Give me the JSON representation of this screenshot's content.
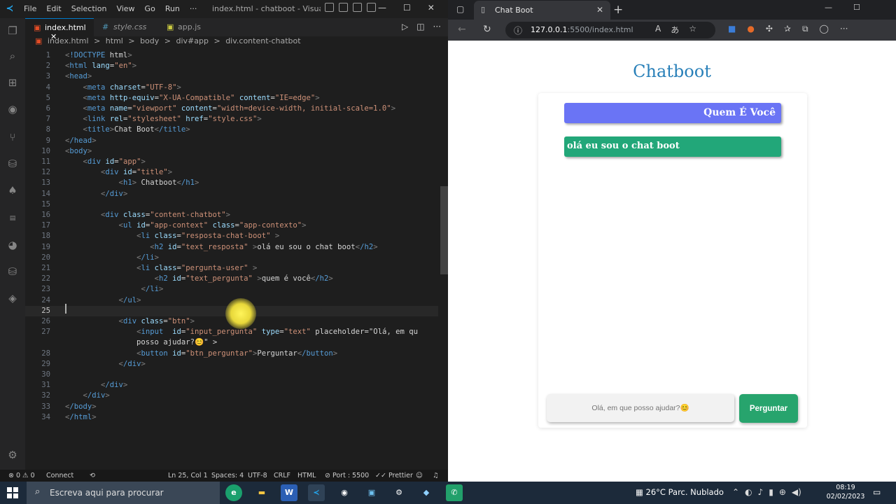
{
  "vscode": {
    "menu": [
      "File",
      "Edit",
      "Selection",
      "View",
      "Go",
      "Run",
      "···"
    ],
    "window_title": "index.html - chatboot - Visual Stud...",
    "window_controls": [
      "—",
      "☐",
      "✕"
    ],
    "tabs": [
      {
        "label": "index.html",
        "icon": "html5-icon",
        "active": true,
        "close": "✕"
      },
      {
        "label": "style.css",
        "icon": "css-icon",
        "active": false
      },
      {
        "label": "app.js",
        "icon": "js-icon",
        "active": false
      }
    ],
    "breadcrumb": [
      "index.html",
      ">",
      "html",
      ">",
      "body",
      ">",
      "div#app",
      ">",
      "div.content-chatbot"
    ],
    "code_lines": [
      {
        "n": "1",
        "code": "<!DOCTYPE html>"
      },
      {
        "n": "2",
        "code": "<html lang=\"en\">"
      },
      {
        "n": "3",
        "code": "<head>"
      },
      {
        "n": "4",
        "code": "    <meta charset=\"UTF-8\">"
      },
      {
        "n": "5",
        "code": "    <meta http-equiv=\"X-UA-Compatible\" content=\"IE=edge\">"
      },
      {
        "n": "6",
        "code": "    <meta name=\"viewport\" content=\"width=device-width, initial-scale=1.0\">"
      },
      {
        "n": "7",
        "code": "    <link rel=\"stylesheet\" href=\"style.css\">"
      },
      {
        "n": "8",
        "code": "    <title>Chat Boot</title>"
      },
      {
        "n": "9",
        "code": "</head>"
      },
      {
        "n": "10",
        "code": "<body>"
      },
      {
        "n": "11",
        "code": "    <div id=\"app\">"
      },
      {
        "n": "12",
        "code": "        <div id=\"title\">"
      },
      {
        "n": "13",
        "code": "            <h1> Chatboot</h1>"
      },
      {
        "n": "14",
        "code": "        </div>"
      },
      {
        "n": "15",
        "code": ""
      },
      {
        "n": "16",
        "code": "        <div class=\"content-chatbot\">"
      },
      {
        "n": "17",
        "code": "            <ul id=\"app-context\" class=\"app-contexto\">"
      },
      {
        "n": "18",
        "code": "                <li class=\"resposta-chat-boot\" >"
      },
      {
        "n": "19",
        "code": "                   <h2 id=\"text_resposta\" >olá eu sou o chat boot</h2>"
      },
      {
        "n": "20",
        "code": "                </li>"
      },
      {
        "n": "21",
        "code": "                <li class=\"pergunta-user\" >"
      },
      {
        "n": "22",
        "code": "                    <h2 id=\"text_pergunta\" >quem é você</h2>"
      },
      {
        "n": "23",
        "code": "                 </li>"
      },
      {
        "n": "24",
        "code": "            </ul>"
      },
      {
        "n": "25",
        "code": ""
      },
      {
        "n": "26",
        "code": "            <div class=\"btn\">"
      },
      {
        "n": "27",
        "code": "                <input  id=\"input_pergunta\" type=\"text\" placeholder=\"Olá, em que"
      },
      {
        "n": "",
        "code": "                posso ajudar?😊\" >"
      },
      {
        "n": "28",
        "code": "                <button id=\"btn_perguntar\">Perguntar</button>"
      },
      {
        "n": "29",
        "code": "            </div>"
      },
      {
        "n": "30",
        "code": ""
      },
      {
        "n": "31",
        "code": "        </div>"
      },
      {
        "n": "32",
        "code": "    </div>"
      },
      {
        "n": "33",
        "code": "</body>"
      },
      {
        "n": "34",
        "code": "</html>"
      }
    ],
    "current_line": "25",
    "status": {
      "problems": "⊗ 0 ⚠ 0",
      "connect": "Connect",
      "position": "Ln 25, Col 1",
      "spaces": "Spaces: 4",
      "encoding": "UTF-8",
      "eol": "CRLF",
      "language": "HTML",
      "port": "⊘ Port : 5500",
      "prettier": "✓✓ Prettier"
    }
  },
  "browser": {
    "tab_title": "Chat Boot",
    "url_host": "127.0.0.1",
    "url_path": ":5500/index.html",
    "page": {
      "title": "Chatboot",
      "question": "Quem É Você",
      "answer": "olá eu sou o chat boot",
      "input_placeholder": "Olá, em que posso ajudar?😊",
      "button_label": "Perguntar"
    },
    "colors": {
      "title": "#2980b9",
      "question_bg": "#6a74f5",
      "answer_bg": "#22a779",
      "button_bg": "#27a46d"
    }
  },
  "taskbar": {
    "search_placeholder": "Escreva aqui para procurar",
    "weather": "26°C  Parc. Nublado",
    "time": "08:19",
    "date": "02/02/2023"
  }
}
